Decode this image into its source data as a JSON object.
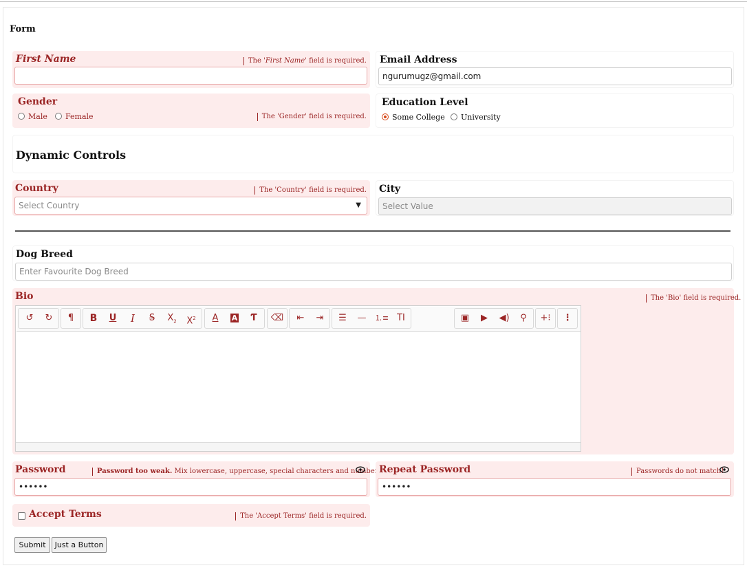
{
  "form_title": "Form",
  "first_name": {
    "label": "First Name",
    "error_prefix": "The '",
    "error_field": "First Name",
    "error_suffix": "' field is required.",
    "value": ""
  },
  "email": {
    "label": "Email Address",
    "value": "ngurumugz@gmail.com"
  },
  "gender": {
    "label": "Gender",
    "options": [
      "Male",
      "Female"
    ],
    "error": "The 'Gender' field is required."
  },
  "education": {
    "label": "Education Level",
    "options": [
      "Some College",
      "University"
    ],
    "selected": "Some College"
  },
  "dynamic_controls": {
    "title": "Dynamic Controls"
  },
  "country": {
    "label": "Country",
    "placeholder": "Select Country",
    "error": "The 'Country' field is required."
  },
  "city": {
    "label": "City",
    "placeholder": "Select Value"
  },
  "dog_breed": {
    "label": "Dog Breed",
    "placeholder": "Enter Favourite Dog Breed"
  },
  "bio": {
    "label": "Bio",
    "error": "The 'Bio' field is required.",
    "toolbar_icons": [
      "undo-icon",
      "redo-icon",
      "paragraph-icon",
      "bold-icon",
      "underline-icon",
      "italic-icon",
      "strikethrough-icon",
      "subscript-icon",
      "superscript-icon",
      "font-color-icon",
      "highlight-icon",
      "clear-format-icon",
      "eraser-icon",
      "outdent-icon",
      "indent-icon",
      "align-icon",
      "horizontal-rule-icon",
      "ordered-list-icon",
      "text-size-icon",
      "image-icon",
      "video-icon",
      "audio-icon",
      "link-icon",
      "insert-more-icon",
      "more-options-icon"
    ]
  },
  "password": {
    "label": "Password",
    "value": "••••••",
    "error_strong": "Password too weak.",
    "error": " Mix lowercase, uppercase, special characters and numbers"
  },
  "repeat_password": {
    "label": "Repeat Password",
    "value": "••••••",
    "error": "Passwords do not match!"
  },
  "accept_terms": {
    "label": "Accept Terms",
    "error": "The 'Accept Terms' field is required."
  },
  "buttons": {
    "submit": "Submit",
    "just_a_button": "Just a Button"
  },
  "colors": {
    "error_text": "#9b2525",
    "error_bg": "#fdecec",
    "radio_accent": "#d84a1b"
  }
}
